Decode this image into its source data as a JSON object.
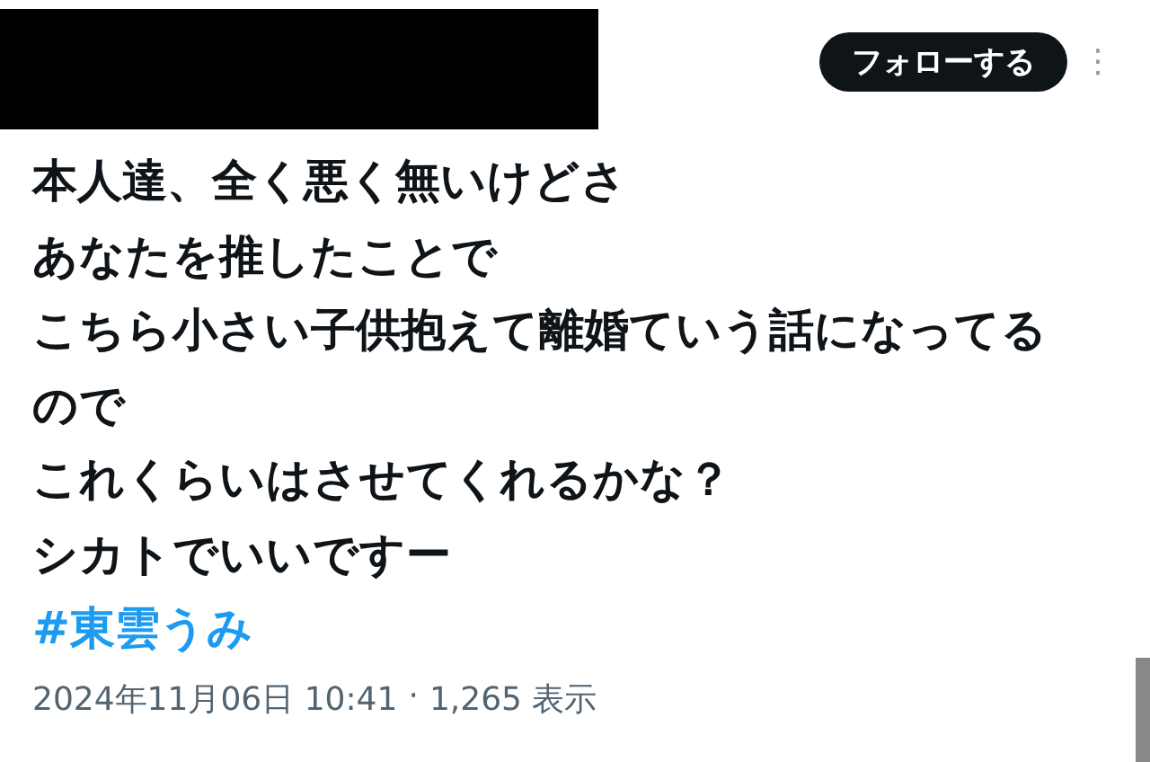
{
  "header": {
    "follow_button": "フォローする",
    "more_icon": "⋮"
  },
  "body": [
    "本人達、全く悪く無いけどさ",
    "あなたを推したことで",
    "こちら小さい子供抱えて離婚ていう話になってる",
    "ので",
    "これくらいはさせてくれるかな？",
    "シカトでいいですー"
  ],
  "hashtag": "#東雲うみ",
  "meta": {
    "time": "2024年11月06日 10:41",
    "separator": "·",
    "views": "1,265 表示"
  }
}
